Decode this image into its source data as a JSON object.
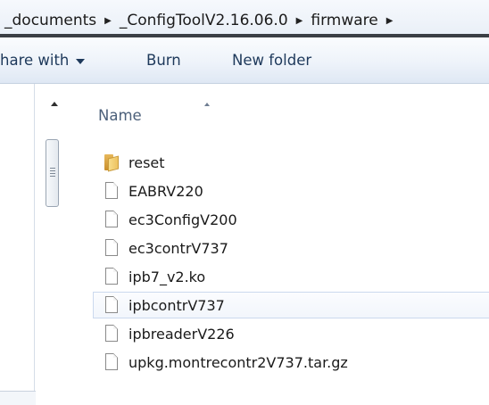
{
  "address": {
    "crumbs": [
      "_documents",
      "_ConfigToolV2.16.06.0",
      "firmware"
    ],
    "separator_icon": "chevron-right-icon"
  },
  "commandbar": {
    "share_with": "hare with",
    "burn": "Burn",
    "new_folder": "New folder"
  },
  "filelist": {
    "column_header": "Name",
    "sort_indicator": "sort-ascending-icon",
    "items": [
      {
        "name": "reset",
        "icon": "folder-icon"
      },
      {
        "name": "EABRV220",
        "icon": "file-icon"
      },
      {
        "name": "ec3ConfigV200",
        "icon": "file-icon"
      },
      {
        "name": "ec3contrV737",
        "icon": "file-icon"
      },
      {
        "name": "ipb7_v2.ko",
        "icon": "file-icon"
      },
      {
        "name": "ipbcontrV737",
        "icon": "file-icon",
        "selected": true
      },
      {
        "name": "ipbreaderV226",
        "icon": "file-icon"
      },
      {
        "name": "upkg.montrecontr2V737.tar.gz",
        "icon": "file-icon"
      }
    ]
  },
  "colors": {
    "command_text": "#1e395b",
    "header_text": "#4c607a",
    "selection_border": "#cbd9ee"
  }
}
